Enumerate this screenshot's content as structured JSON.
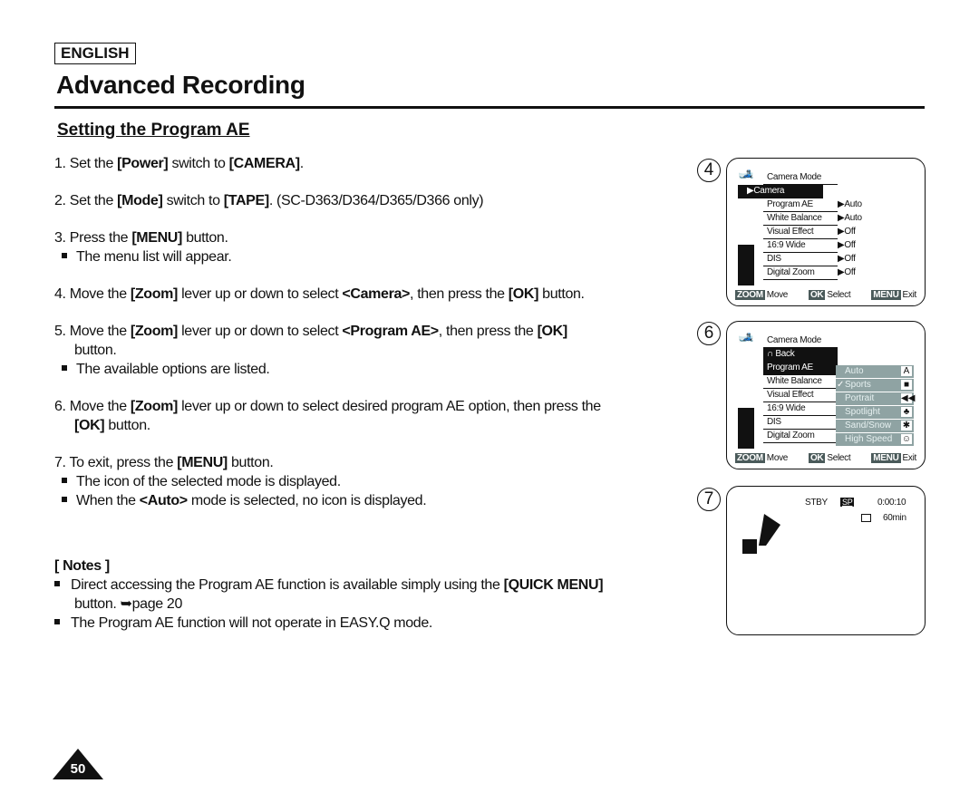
{
  "header": {
    "language": "ENGLISH",
    "title": "Advanced Recording",
    "subtitle": "Setting the Program AE"
  },
  "steps": [
    {
      "num": "1.",
      "pre": "Set the ",
      "b1": "[Power]",
      "mid": " switch to ",
      "b2": "[CAMERA]",
      "post": "."
    },
    {
      "num": "2.",
      "pre": "Set the ",
      "b1": "[Mode]",
      "mid": " switch to ",
      "b2": "[TAPE]",
      "post": ". (SC-D363/D364/D365/D366 only)"
    },
    {
      "num": "3.",
      "pre": "Press the ",
      "b1": "[MENU]",
      "post": " button.",
      "bullets": [
        "The menu list will appear."
      ]
    },
    {
      "num": "4.",
      "pre": "Move the ",
      "b1": "[Zoom]",
      "mid": " lever up or down to select ",
      "b2": "<Camera>",
      "mid2": ", then press the ",
      "b3": "[OK]",
      "post": " button."
    },
    {
      "num": "5.",
      "pre": "Move the ",
      "b1": "[Zoom]",
      "mid": " lever up or down to select ",
      "b2": "<Program AE>",
      "mid2": ", then press the ",
      "b3": "[OK]",
      "cont": "button.",
      "bullets": [
        "The available options are listed."
      ]
    },
    {
      "num": "6.",
      "pre": "Move the ",
      "b1": "[Zoom]",
      "mid": " lever up or down to select desired program AE option, then press the",
      "b2": "[OK]",
      "cont": " button."
    },
    {
      "num": "7.",
      "pre": "To exit, press the ",
      "b1": "[MENU]",
      "post": " button.",
      "bullets": [
        "The icon of the selected mode is displayed."
      ],
      "bullet2_pre": "When the ",
      "bullet2_b": "<Auto>",
      "bullet2_post": " mode is selected, no icon is displayed."
    }
  ],
  "notes": {
    "heading": "[ Notes ]",
    "n1_pre": "Direct accessing the Program AE function is available simply using the ",
    "n1_b": "[QUICK MENU]",
    "n1_cont": "button. ➥page 20",
    "n2": "The Program AE function will not operate in EASY.Q mode."
  },
  "page_number": "50",
  "screens": {
    "s4": {
      "label": "4",
      "menu_title": "Camera Mode",
      "selected": "▶Camera",
      "items": [
        "Program AE",
        "White Balance",
        "Visual Effect",
        "16:9 Wide",
        "DIS",
        "Digital Zoom"
      ],
      "values": [
        "▶Auto",
        "▶Auto",
        "▶Off",
        "▶Off",
        "▶Off",
        "▶Off"
      ]
    },
    "s6": {
      "label": "6",
      "menu_title": "Camera Mode",
      "back": "∩ Back",
      "items": [
        "Program AE",
        "White Balance",
        "Visual Effect",
        "16:9 Wide",
        "DIS",
        "Digital Zoom"
      ],
      "options": [
        {
          "label": "Auto",
          "icon": "A",
          "checked": false
        },
        {
          "label": "Sports",
          "icon": "■",
          "checked": true
        },
        {
          "label": "Portrait",
          "icon": "◀◀",
          "checked": false
        },
        {
          "label": "Spotlight",
          "icon": "♣",
          "checked": false
        },
        {
          "label": "Sand/Snow",
          "icon": "✱",
          "checked": false
        },
        {
          "label": "High Speed",
          "icon": "☺",
          "checked": false
        }
      ]
    },
    "s7": {
      "label": "7",
      "stby": "STBY",
      "sp": "SP",
      "time": "0:00:10",
      "remain": "60min"
    },
    "footer": {
      "zoom": "ZOOM",
      "move": "Move",
      "ok": "OK",
      "select": "Select",
      "menu": "MENU",
      "exit": "Exit"
    }
  }
}
